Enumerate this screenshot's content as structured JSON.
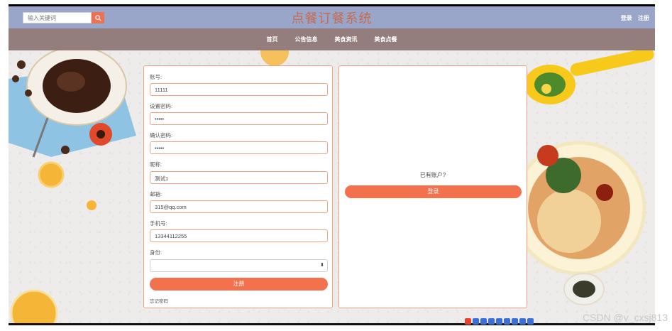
{
  "header": {
    "search_placeholder": "输入关键词",
    "title": "点餐订餐系统",
    "login_link": "登录",
    "register_link": "注册"
  },
  "nav": {
    "items": [
      "首页",
      "公告信息",
      "美食资讯",
      "美食点餐"
    ]
  },
  "form": {
    "fields": [
      {
        "label": "账号:",
        "value": "11111"
      },
      {
        "label": "设置密码:",
        "value": "•••••"
      },
      {
        "label": "确认密码:",
        "value": "•••••"
      },
      {
        "label": "昵称:",
        "value": "测试1"
      },
      {
        "label": "邮箱:",
        "value": "315@qq.com"
      },
      {
        "label": "手机号:",
        "value": "13344112255"
      }
    ],
    "role_label": "身份:",
    "role_value": "",
    "submit_label": "注册",
    "forgot_label": "忘记密码"
  },
  "side": {
    "has_account_text": "已有账户?",
    "login_button": "登录"
  },
  "watermark": "CSDN @v_cxsj813",
  "colors": {
    "header_bg": "#9aa6c9",
    "nav_bg": "#947d7d",
    "accent": "#f3714c",
    "title_color": "#c56b4d"
  }
}
